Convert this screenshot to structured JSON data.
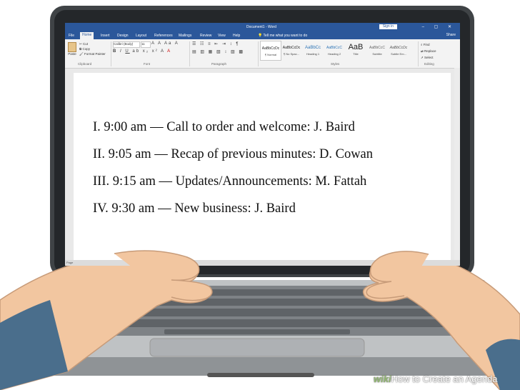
{
  "word": {
    "title": "Document1 - Word",
    "sign_in": "Sign in",
    "tabs": [
      "File",
      "Home",
      "Insert",
      "Design",
      "Layout",
      "References",
      "Mailings",
      "Review",
      "View",
      "Help"
    ],
    "tell_me": "Tell me what you want to do",
    "share": "Share",
    "clipboard": {
      "paste": "Paste",
      "cut": "Cut",
      "copy": "Copy",
      "format_painter": "Format Painter",
      "label": "Clipboard"
    },
    "font": {
      "name": "Calibri (Body)",
      "size": "11",
      "label": "Font"
    },
    "paragraph": {
      "label": "Paragraph"
    },
    "styles": {
      "label": "Styles",
      "items": [
        {
          "sample": "AaBbCcDc",
          "name": "¶ Normal"
        },
        {
          "sample": "AaBbCcDc",
          "name": "¶ No Spac..."
        },
        {
          "sample": "AaBbCc",
          "name": "Heading 1"
        },
        {
          "sample": "AaBbCcC",
          "name": "Heading 2"
        },
        {
          "sample": "AaB",
          "name": "Title"
        },
        {
          "sample": "AaBbCcC",
          "name": "Subtitle"
        },
        {
          "sample": "AaBbCcDc",
          "name": "Subtle Em..."
        }
      ]
    },
    "editing": {
      "find": "Find",
      "replace": "Replace",
      "select": "Select",
      "label": "Editing"
    },
    "document_lines": [
      "I. 9:00 am — Call to order and welcome: J. Baird",
      "II. 9:05 am — Recap of previous minutes: D. Cowan",
      "III. 9:15 am — Updates/Announcements: M. Fattah",
      "IV. 9:30 am — New business: J. Baird"
    ],
    "status": "Page"
  },
  "watermark": {
    "brand": "wiki",
    "text": "How to Create an Agenda"
  },
  "colors": {
    "word_blue": "#2b579a",
    "laptop_frame": "#4a4e52",
    "skin": "#f2c6a0"
  }
}
